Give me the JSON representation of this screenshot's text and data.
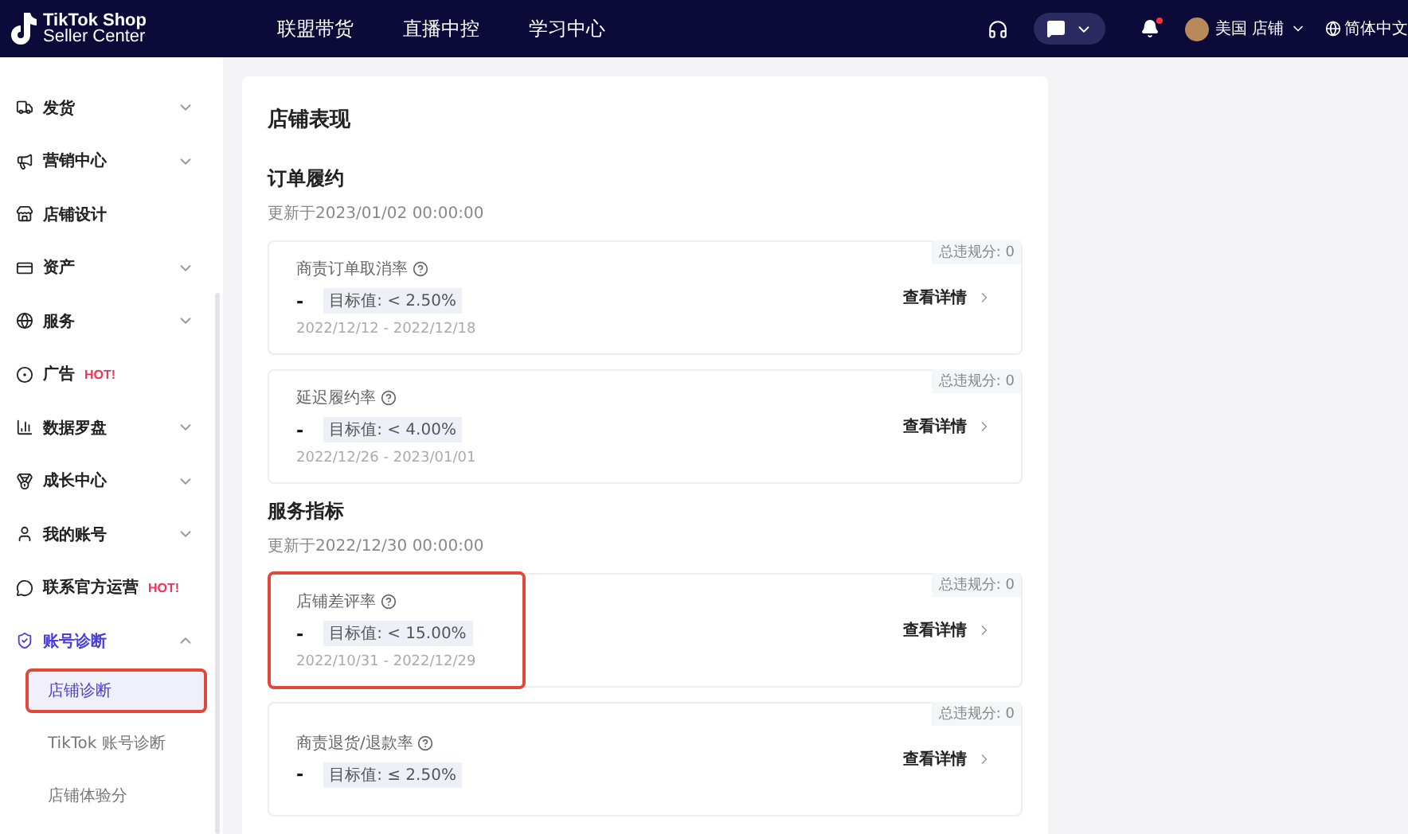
{
  "header": {
    "logo_line1": "TikTok Shop",
    "logo_line2": "Seller Center",
    "nav": [
      {
        "label": "联盟带货"
      },
      {
        "label": "直播中控"
      },
      {
        "label": "学习中心"
      }
    ],
    "notification_dot": true,
    "account": "美国 店铺",
    "language": "简体中文"
  },
  "sidebar": {
    "items": [
      {
        "label": "发货",
        "expanded": false
      },
      {
        "label": "营销中心",
        "expanded": false
      },
      {
        "label": "店铺设计"
      },
      {
        "label": "资产",
        "expanded": false
      },
      {
        "label": "服务",
        "expanded": false
      },
      {
        "label": "广告",
        "badge": "HOT!"
      },
      {
        "label": "数据罗盘",
        "expanded": false
      },
      {
        "label": "成长中心",
        "expanded": false
      },
      {
        "label": "我的账号",
        "expanded": false
      },
      {
        "label": "联系官方运营",
        "badge": "HOT!"
      },
      {
        "label": "账号诊断",
        "expanded": true,
        "children": [
          {
            "label": "店铺诊断",
            "selected": true,
            "highlighted": true
          },
          {
            "label": "TikTok 账号诊断",
            "selected": false,
            "highlighted": false
          },
          {
            "label": "店铺体验分",
            "selected": false,
            "highlighted": false
          }
        ]
      }
    ]
  },
  "panel": {
    "title": "店铺表现",
    "sections": [
      {
        "title": "订单履约",
        "updated": "更新于2023/01/02 00:00:00",
        "cards": [
          {
            "name": "商责订单取消率",
            "value": "-",
            "target": "目标值: < 2.50%",
            "dates": "2022/12/12 - 2022/12/18",
            "points": "总违规分: 0",
            "link": "查看详情",
            "highlighted": false
          },
          {
            "name": "延迟履约率",
            "value": "-",
            "target": "目标值: < 4.00%",
            "dates": "2022/12/26 - 2023/01/01",
            "points": "总违规分: 0",
            "link": "查看详情",
            "highlighted": false
          }
        ]
      },
      {
        "title": "服务指标",
        "updated": "更新于2022/12/30 00:00:00",
        "cards": [
          {
            "name": "店铺差评率",
            "value": "-",
            "target": "目标值: < 15.00%",
            "dates": "2022/10/31 - 2022/12/29",
            "points": "总违规分: 0",
            "link": "查看详情",
            "highlighted": true
          },
          {
            "name": "商责退货/退款率",
            "value": "-",
            "target": "目标值: ≤ 2.50%",
            "points": "总违规分: 0",
            "link": "查看详情",
            "highlighted": false
          }
        ]
      }
    ]
  }
}
